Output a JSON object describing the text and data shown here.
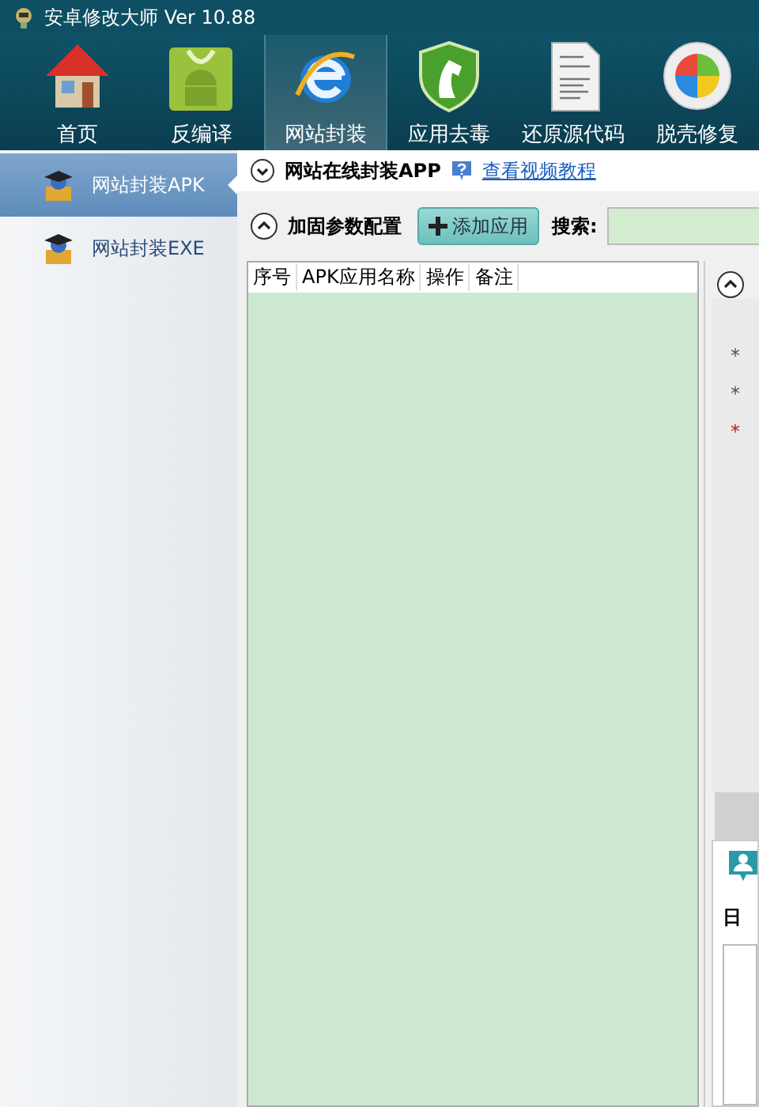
{
  "app": {
    "title": "安卓修改大师 Ver 10.88"
  },
  "toolbar": [
    {
      "label": "首页",
      "kind": "house",
      "selected": false
    },
    {
      "label": "反编译",
      "kind": "android",
      "selected": false
    },
    {
      "label": "网站封装",
      "kind": "browser",
      "selected": true
    },
    {
      "label": "应用去毒",
      "kind": "shield",
      "selected": false
    },
    {
      "label": "还原源代码",
      "kind": "document",
      "selected": false
    },
    {
      "label": "脱壳修复",
      "kind": "orb",
      "selected": false
    }
  ],
  "sidebar": {
    "items": [
      {
        "label": "网站封装APK",
        "selected": true
      },
      {
        "label": "网站封装EXE",
        "selected": false
      }
    ]
  },
  "section": {
    "title": "网站在线封装APP",
    "link": "查看视频教程"
  },
  "config": {
    "title": "加固参数配置",
    "add_button": "添加应用",
    "search_label": "搜索:"
  },
  "table": {
    "columns": [
      "序号",
      "APK应用名称",
      "操作",
      "备注"
    ]
  },
  "right_panel": {
    "marks": [
      {
        "text": "*",
        "required": false
      },
      {
        "text": "*",
        "required": false
      },
      {
        "text": "*",
        "required": true
      }
    ],
    "log_label": "日"
  }
}
